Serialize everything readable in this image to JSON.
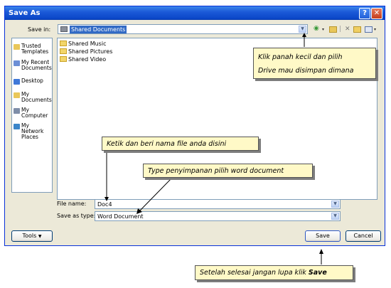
{
  "window": {
    "title": "Save As",
    "help_glyph": "?",
    "close_glyph": "✕"
  },
  "save_in": {
    "label": "Save in:",
    "value": "Shared Documents"
  },
  "toolbar": {
    "back_icon": "back-arrow-icon",
    "up_icon": "up-folder-icon",
    "delete_icon": "delete-icon",
    "new_folder_icon": "new-folder-icon",
    "views_icon": "views-icon"
  },
  "places": [
    {
      "label": "Trusted Templates",
      "icon": "folder-icon",
      "color": "#e9c75a"
    },
    {
      "label": "My Recent Documents",
      "icon": "recent-docs-icon",
      "color": "#6b8fd6"
    },
    {
      "label": "Desktop",
      "icon": "desktop-icon",
      "color": "#3f78d8"
    },
    {
      "label": "My Documents",
      "icon": "my-documents-icon",
      "color": "#e9c75a"
    },
    {
      "label": "My Computer",
      "icon": "computer-icon",
      "color": "#7f8ea8"
    },
    {
      "label": "My Network Places",
      "icon": "network-icon",
      "color": "#3c86c9"
    }
  ],
  "files": [
    {
      "name": "Shared Music",
      "icon": "folder-music-icon"
    },
    {
      "name": "Shared Pictures",
      "icon": "folder-pictures-icon"
    },
    {
      "name": "Shared Video",
      "icon": "folder-video-icon"
    }
  ],
  "filename": {
    "label": "File name:",
    "value": "Doc4"
  },
  "filetype": {
    "label": "Save as type:",
    "value": "Word Document"
  },
  "buttons": {
    "tools": "Tools",
    "save": "Save",
    "cancel": "Cancel"
  },
  "annotations": {
    "drive_line1": "Klik panah kecil dan pilih",
    "drive_line2": "Drive mau disimpan dimana",
    "filename_note": "Ketik dan beri nama file anda disini",
    "type_note": "Type penyimpanan pilih word document",
    "save_note_prefix": "Setelah selesai jangan lupa klik ",
    "save_note_bold": "Save"
  },
  "colors": {
    "titlebar": "#0a46c8",
    "dialog_bg": "#ece9d8",
    "note_bg": "#fff9c7",
    "highlight": "#316ac5"
  }
}
